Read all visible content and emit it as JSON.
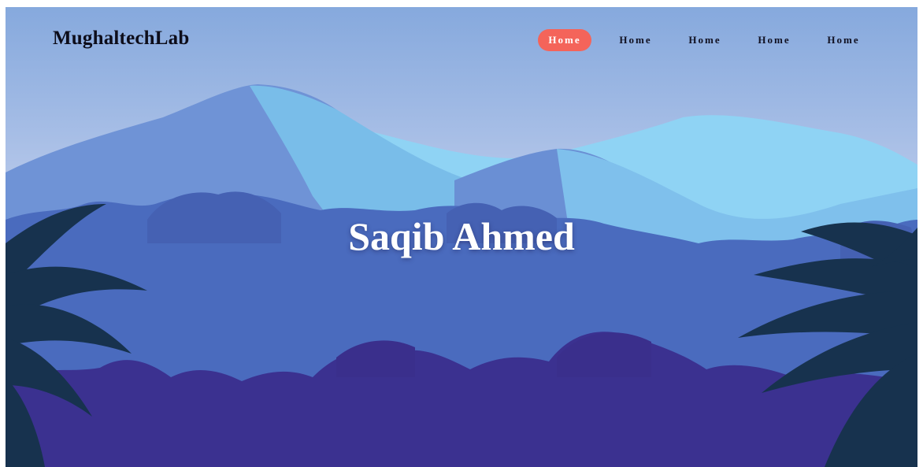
{
  "brand": {
    "name": "MughaltechLab"
  },
  "nav": {
    "items": [
      {
        "label": "Home",
        "active": true
      },
      {
        "label": "Home",
        "active": false
      },
      {
        "label": "Home",
        "active": false
      },
      {
        "label": "Home",
        "active": false
      },
      {
        "label": "Home",
        "active": false
      }
    ]
  },
  "hero": {
    "title": "Saqib Ahmed"
  },
  "colors": {
    "sky_top": "#86a9dd",
    "mountain_light": "#7fc8f0",
    "mountain_mid": "#6a8fd4",
    "forest_mid": "#4466b8",
    "forest_front": "#3b3190",
    "palm_leaf": "#16324f",
    "accent": "#f4645a"
  }
}
